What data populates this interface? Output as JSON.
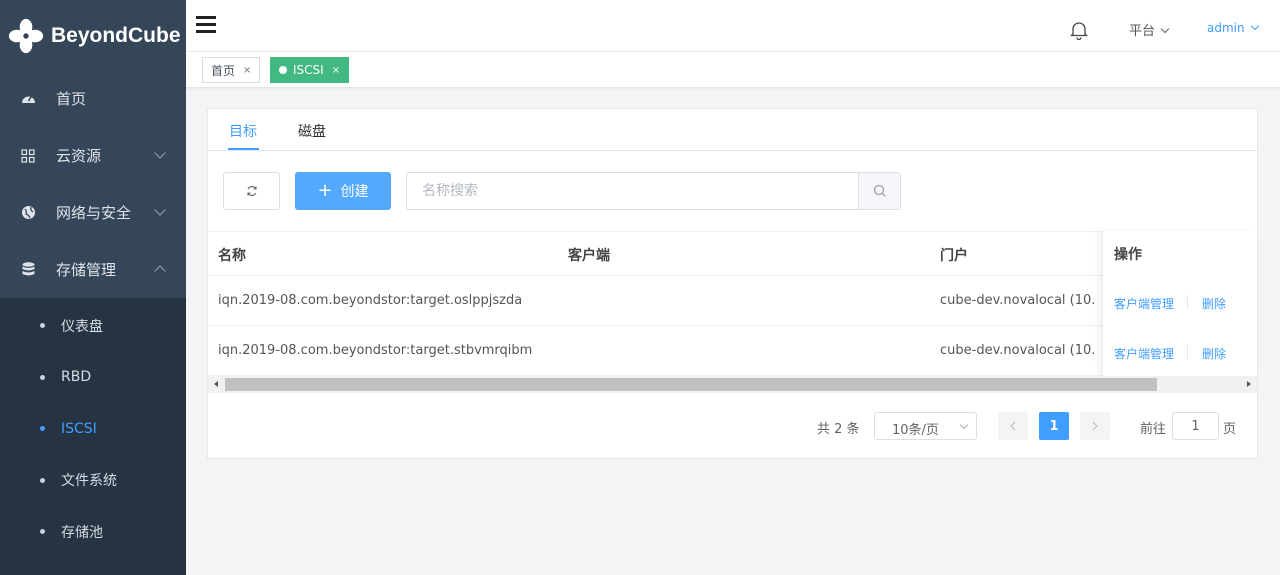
{
  "brand": {
    "name": "BeyondCube",
    "colors": {
      "sidebar": "#344658",
      "submenu": "#253342",
      "accent": "#409eff",
      "tag_active": "#42b983"
    }
  },
  "sidebar": {
    "items": [
      {
        "label": "首页",
        "icon": "dashboard-icon"
      },
      {
        "label": "云资源",
        "icon": "grid-icon",
        "expandable": true
      },
      {
        "label": "网络与安全",
        "icon": "globe-icon",
        "expandable": true
      },
      {
        "label": "存储管理",
        "icon": "database-icon",
        "expanded": true
      }
    ],
    "sub_items": [
      {
        "label": "仪表盘"
      },
      {
        "label": "RBD"
      },
      {
        "label": "ISCSI",
        "active": true
      },
      {
        "label": "文件系统"
      },
      {
        "label": "存储池"
      }
    ]
  },
  "header": {
    "platform": "平台",
    "user": "admin"
  },
  "tags": [
    {
      "label": "首页",
      "close": "×"
    },
    {
      "label": "ISCSI",
      "close": "×",
      "active": true
    }
  ],
  "tabs": [
    {
      "label": "目标",
      "active": true
    },
    {
      "label": "磁盘"
    }
  ],
  "toolbar": {
    "create_label": "创建",
    "search_placeholder": "名称搜索"
  },
  "table": {
    "columns": [
      "名称",
      "客户端",
      "门户",
      "操作"
    ],
    "rows": [
      {
        "name": "iqn.2019-08.com.beyondstor:target.oslppjszda",
        "client": "",
        "portal": "cube-dev.novalocal   (10.",
        "actions": [
          "客户端管理",
          "删除"
        ]
      },
      {
        "name": "iqn.2019-08.com.beyondstor:target.stbvmrqibm",
        "client": "",
        "portal": "cube-dev.novalocal   (10.",
        "actions": [
          "客户端管理",
          "删除"
        ]
      }
    ]
  },
  "pagination": {
    "total": "共 2 条",
    "page_size": "10条/页",
    "current_page": "1",
    "goto_prefix": "前往",
    "goto_value": "1",
    "goto_suffix": "页"
  }
}
